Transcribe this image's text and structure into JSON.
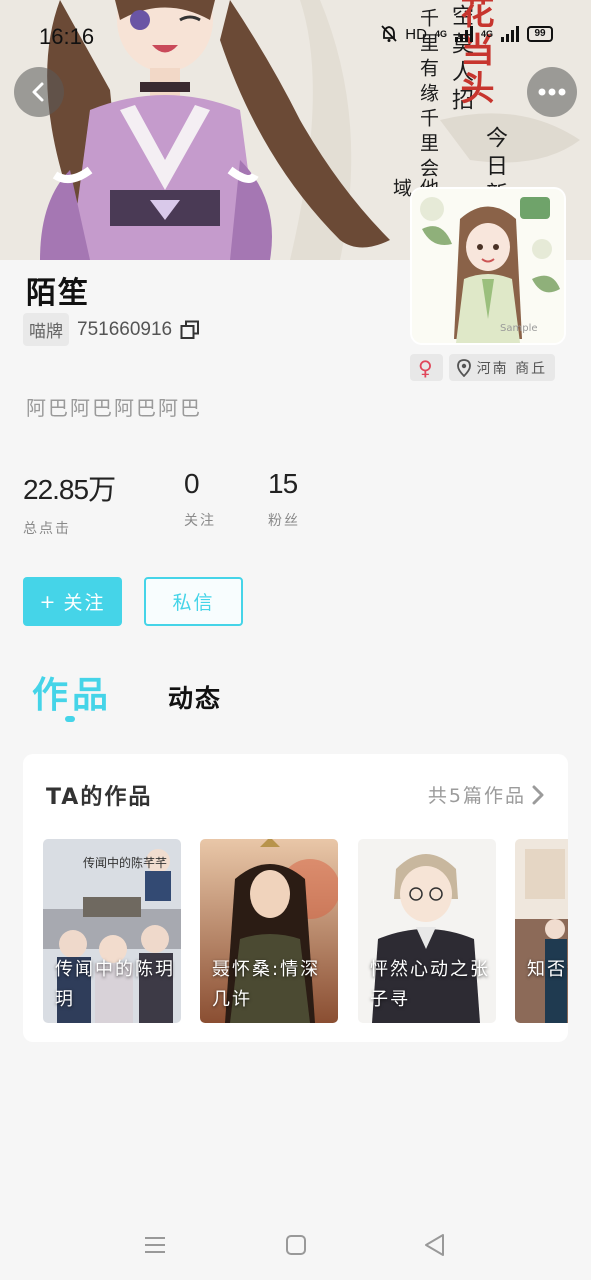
{
  "status_bar": {
    "time": "16:16",
    "network": "HD",
    "signal_1": "4G",
    "signal_2": "4G",
    "battery": "99"
  },
  "banner": {
    "calligraphy_cols": [
      "空莫人招",
      "千里有缘千里会",
      "今日新",
      "他乡异域"
    ],
    "calligraphy_red": "花当头"
  },
  "profile": {
    "name": "陌笙",
    "id_tag": "喵牌",
    "id_number": "751660916",
    "bio": "阿巴阿巴阿巴阿巴",
    "gender_symbol": "♀",
    "location": "河南 商丘"
  },
  "stats": [
    {
      "value": "22.85万",
      "label": "总点击"
    },
    {
      "value": "0",
      "label": "关注"
    },
    {
      "value": "15",
      "label": "粉丝"
    }
  ],
  "actions": {
    "follow_label": "关注",
    "follow_icon": "+",
    "message_label": "私信"
  },
  "tabs": {
    "works": "作品",
    "feed": "动态"
  },
  "works": {
    "title": "TA的作品",
    "count_label": "共5篇作品",
    "items": [
      {
        "title": "传闻中的陈玥玥",
        "cover_text": "传闻中的陈芊芊"
      },
      {
        "title": "聂怀桑:情深几许"
      },
      {
        "title": "怦然心动之张子寻"
      },
      {
        "title": "知否佳人"
      }
    ]
  },
  "colors": {
    "accent": "#45d4e8",
    "gender": "#e0465a"
  }
}
